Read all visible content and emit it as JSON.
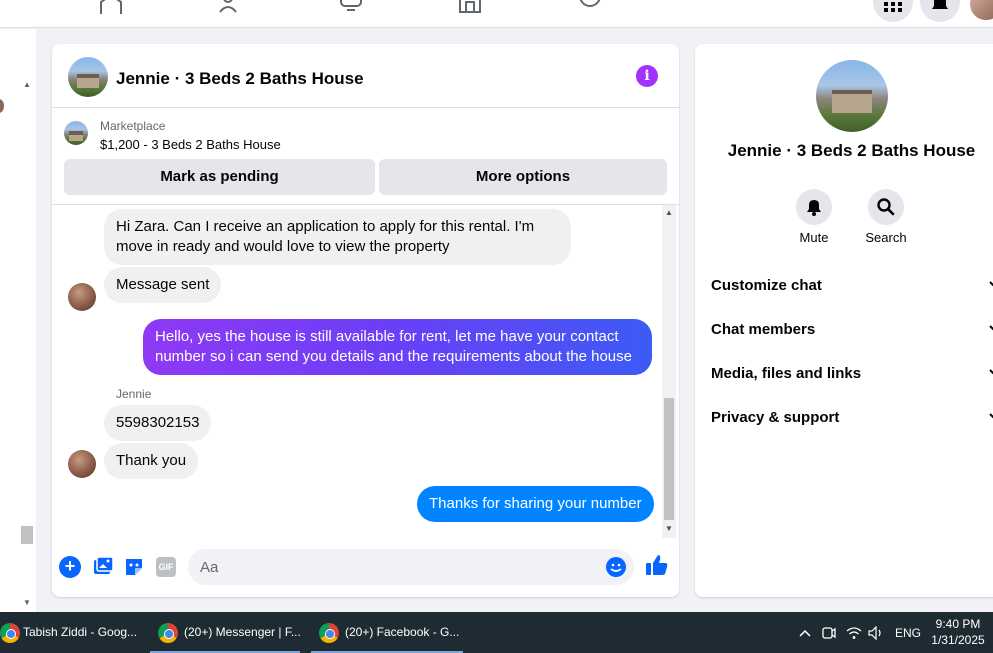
{
  "chat": {
    "title": "Jennie · 3 Beds 2 Baths House",
    "marketplace_label": "Marketplace",
    "listing_price": "$1,200 - 3 Beds 2 Baths House",
    "mark_pending_label": "Mark as pending",
    "more_options_label": "More options",
    "info_glyph": "i"
  },
  "messages": {
    "m1": "Hi Zara. Can I receive an application to apply for this rental. I'm move in ready and would love to view the property",
    "m2": "Message sent",
    "m3": "Hello, yes the house is still available for rent, let me have your contact number so i can send you details and the requirements about the house",
    "sender": "Jennie",
    "m4": "5598302153",
    "m5": "Thank you",
    "m6": "Thanks for sharing your number"
  },
  "composer": {
    "placeholder": "Aa",
    "plus_glyph": "+",
    "gif_label": "GIF"
  },
  "side": {
    "title": "Jennie · 3 Beds 2 Baths House",
    "mute_label": "Mute",
    "search_label": "Search",
    "rows": [
      "Customize chat",
      "Chat members",
      "Media, files and links",
      "Privacy & support"
    ]
  },
  "taskbar": {
    "items": [
      "Tabish Ziddi - Goog...",
      "(20+) Messenger | F...",
      "(20+) Facebook - G..."
    ],
    "lang": "ENG",
    "time": "9:40 PM",
    "date": "1/31/2025"
  },
  "colors": {
    "accent": "#0866ff",
    "outgoing_bubble": "#0084ff",
    "gradient_start": "#8f39f4",
    "info": "#a033ff"
  },
  "icons": [
    "home-icon",
    "friends-icon",
    "watch-icon",
    "marketplace-icon",
    "groups-icon",
    "menu-grid-icon",
    "bell-icon",
    "info-icon",
    "plus-icon",
    "image-icon",
    "sticker-icon",
    "gif-icon",
    "emoji-icon",
    "like-icon",
    "search-icon",
    "chevron-down-icon"
  ]
}
